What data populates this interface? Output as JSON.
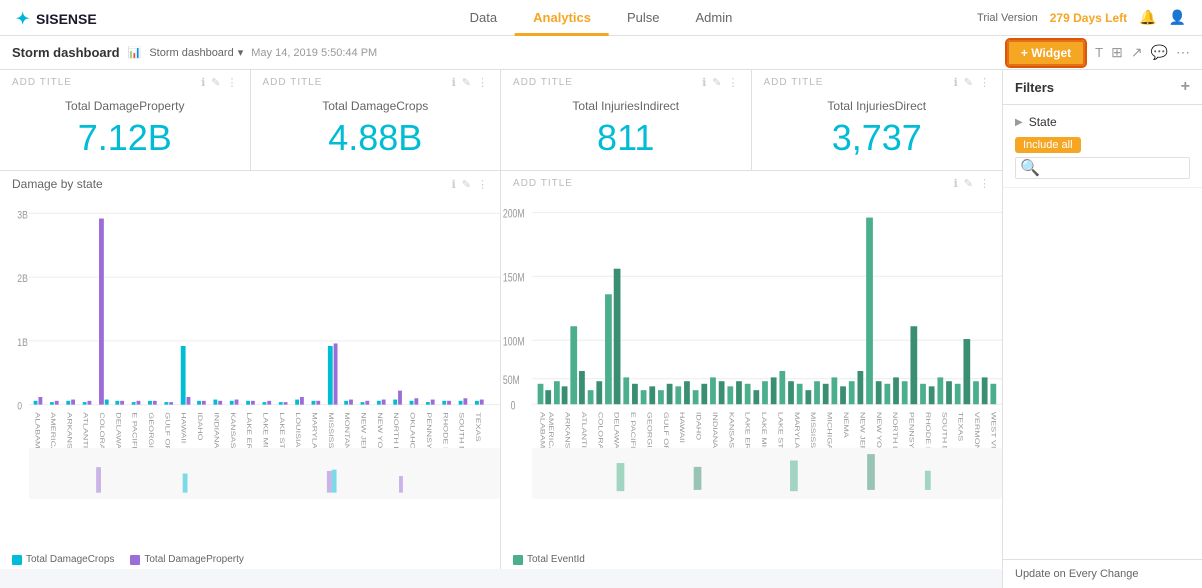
{
  "app": {
    "logo": "SISENSE",
    "nav": {
      "tabs": [
        {
          "label": "Data",
          "active": false
        },
        {
          "label": "Analytics",
          "active": true
        },
        {
          "label": "Pulse",
          "active": false
        },
        {
          "label": "Admin",
          "active": false
        }
      ]
    },
    "trial": {
      "text": "Trial Version",
      "days": "279 Days Left"
    }
  },
  "toolbar": {
    "dashboard_title": "Storm dashboard",
    "breadcrumb": "Storm dashboard",
    "date": "May 14, 2019 5:50:44 PM",
    "add_widget": "+ Widget"
  },
  "widgets": [
    {
      "add_title": "ADD TITLE",
      "metric_label": "Total DamageProperty",
      "metric_value": "7.12B"
    },
    {
      "add_title": "ADD TITLE",
      "metric_label": "Total DamageCrops",
      "metric_value": "4.88B"
    },
    {
      "add_title": "ADD TITLE",
      "metric_label": "Total InjuriesIndirect",
      "metric_value": "811"
    },
    {
      "add_title": "ADD TITLE",
      "metric_label": "Total InjuriesDirect",
      "metric_value": "3,737"
    }
  ],
  "charts": [
    {
      "add_title": "Damage by state",
      "legend": [
        {
          "label": "Total DamageCrops",
          "color": "#00bcd4"
        },
        {
          "label": "Total DamageProperty",
          "color": "#9c6dd8"
        }
      ]
    },
    {
      "add_title": "ADD TITLE",
      "legend": [
        {
          "label": "Total EventId",
          "color": "#4caf8c"
        }
      ]
    }
  ],
  "sidebar": {
    "title": "Filters",
    "add_label": "+",
    "filter_section": {
      "label": "State",
      "tag": "Include all"
    },
    "footer": "Update on Every Change"
  }
}
